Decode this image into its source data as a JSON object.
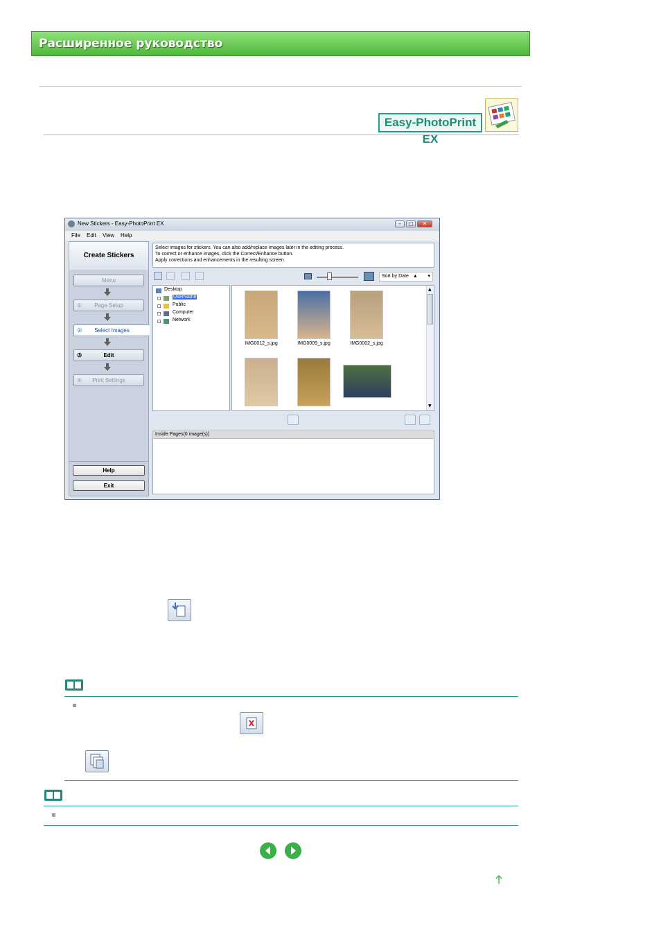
{
  "header": {
    "title": "Расширенное руководство"
  },
  "product": {
    "badge": "Easy-PhotoPrint EX",
    "badge_icon": "product-photo-icon"
  },
  "window": {
    "title": "New Stickers - Easy-PhotoPrint EX",
    "controls": [
      "minimize",
      "maximize",
      "close"
    ],
    "menu": [
      "File",
      "Edit",
      "View",
      "Help"
    ],
    "panel_title": "Create Stickers",
    "nav": [
      {
        "label": "Menu",
        "num": "",
        "state": "disabled"
      },
      {
        "label": "Page Setup",
        "num": "①",
        "state": "disabled"
      },
      {
        "label": "Select Images",
        "num": "②",
        "state": "active"
      },
      {
        "label": "Edit",
        "num": "③",
        "state": "enabled"
      },
      {
        "label": "Print Settings",
        "num": "④",
        "state": "disabled"
      }
    ],
    "help_label": "Help",
    "exit_label": "Exit",
    "instructions": [
      "Select images for stickers. You can also add/replace images later in the editing process.",
      "To correct or enhance images, click the Correct/Enhance button.",
      "Apply corrections and enhancements in the resulting screen."
    ],
    "sort": {
      "selected": "Sort by Date",
      "direction": "▲"
    },
    "tree": [
      {
        "label": "Desktop",
        "selected": false
      },
      {
        "label": "UserName",
        "selected": true
      },
      {
        "label": "Public",
        "selected": false
      },
      {
        "label": "Computer",
        "selected": false
      },
      {
        "label": "Network",
        "selected": false
      }
    ],
    "thumbnails": [
      {
        "label": "IMG0012_s.jpg",
        "color_top": "#c9a77a",
        "color_bottom": "#d8b98a"
      },
      {
        "label": "IMG0009_s.jpg",
        "color_top": "#4a6fa5",
        "color_bottom": "#d9b38e"
      },
      {
        "label": "IMG0002_s.jpg",
        "color_top": "#b9a07e",
        "color_bottom": "#d6bd96"
      },
      {
        "label": "",
        "color_top": "#cbb08d",
        "color_bottom": "#e0c9a5"
      },
      {
        "label": "",
        "color_top": "#9a7a3a",
        "color_bottom": "#c8a15a"
      },
      {
        "label": "",
        "color_top": "#4f6f3f",
        "color_bottom": "#2f3f5f"
      }
    ],
    "inside_pages": "Inside Pages(0 image(s))"
  },
  "colors": {
    "accent_green": "#4fb83a",
    "badge_teal": "#2a9d86",
    "selection_blue": "#3a6fd8"
  }
}
